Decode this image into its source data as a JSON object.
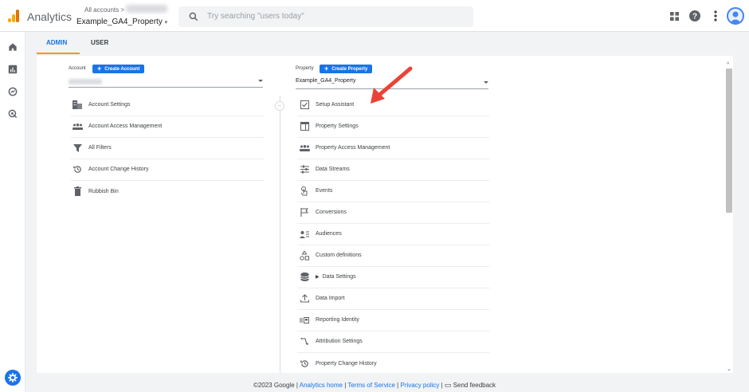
{
  "header": {
    "app_name": "Analytics",
    "account_crumb": "All accounts >",
    "property_name": "Example_GA4_Property",
    "search_placeholder": "Try searching \"users today\""
  },
  "tabs": [
    {
      "label": "ADMIN",
      "active": true
    },
    {
      "label": "USER",
      "active": false
    }
  ],
  "account": {
    "label": "Account",
    "create_label": "Create Account",
    "items": [
      {
        "label": "Account Settings",
        "icon": "building-icon"
      },
      {
        "label": "Account Access Management",
        "icon": "people-icon"
      },
      {
        "label": "All Filters",
        "icon": "filter-icon"
      },
      {
        "label": "Account Change History",
        "icon": "history-icon"
      },
      {
        "label": "Rubbish Bin",
        "icon": "trash-icon"
      }
    ]
  },
  "property": {
    "label": "Property",
    "create_label": "Create Property",
    "selected": "Example_GA4_Property",
    "items": [
      {
        "label": "Setup Assistant",
        "icon": "checkbox-icon"
      },
      {
        "label": "Property Settings",
        "icon": "settings-page-icon"
      },
      {
        "label": "Property Access Management",
        "icon": "people-icon"
      },
      {
        "label": "Data Streams",
        "icon": "streams-icon"
      },
      {
        "label": "Events",
        "icon": "touch-icon"
      },
      {
        "label": "Conversions",
        "icon": "flag-icon"
      },
      {
        "label": "Audiences",
        "icon": "audience-icon"
      },
      {
        "label": "Custom definitions",
        "icon": "shapes-icon"
      },
      {
        "label": "Data Settings",
        "icon": "database-icon"
      },
      {
        "label": "Data Import",
        "icon": "upload-icon"
      },
      {
        "label": "Reporting Identity",
        "icon": "identity-icon"
      },
      {
        "label": "Attribution Settings",
        "icon": "attribution-icon"
      },
      {
        "label": "Property Change History",
        "icon": "history-icon"
      }
    ]
  },
  "footer": {
    "copyright": "©2023 Google |",
    "links": [
      "Analytics home",
      "Terms of Service",
      "Privacy policy"
    ],
    "feedback": "Send feedback"
  },
  "colors": {
    "accent": "#1a73e8",
    "tab_underline": "#f29900",
    "arrow": "#ea4335"
  }
}
